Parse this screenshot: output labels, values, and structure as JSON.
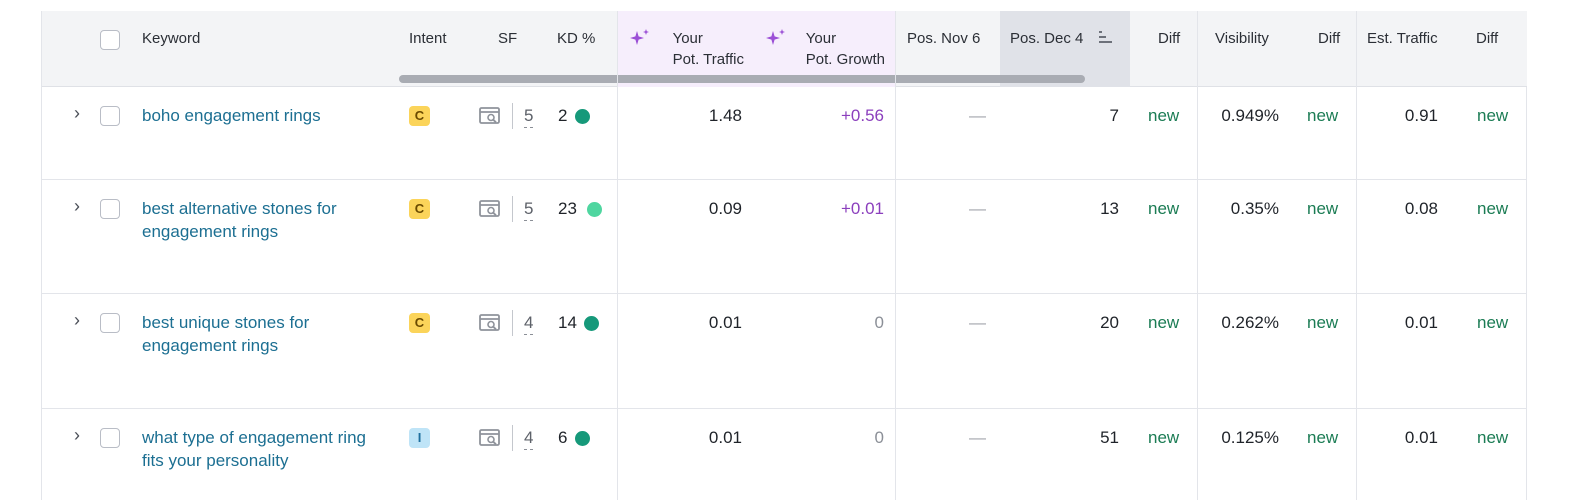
{
  "header": {
    "keyword": "Keyword",
    "intent": "Intent",
    "sf": "SF",
    "kd": "KD %",
    "pot_traffic_1": "Your",
    "pot_traffic_2": "Pot. Traffic",
    "pot_growth_1": "Your",
    "pot_growth_2": "Pot. Growth",
    "pos_prev": "Pos. Nov 6",
    "pos_curr": "Pos. Dec 4",
    "diff1": "Diff",
    "visibility": "Visibility",
    "diff2": "Diff",
    "est_traffic": "Est. Traffic",
    "diff3": "Diff"
  },
  "colors": {
    "kd_green_dark": "#16997a",
    "kd_green_light": "#4fd6a0",
    "ai_purple": "#9b4fd6"
  },
  "rows": [
    {
      "keyword": "boho engagement rings",
      "intent": "C",
      "sf": "5",
      "kd": "2",
      "pot_traffic": "1.48",
      "pot_growth": "+0.56",
      "pos_prev": "—",
      "pos_curr": "7",
      "diff1": "new",
      "visibility": "0.949%",
      "diff2": "new",
      "est_traffic": "0.91",
      "diff3": "new"
    },
    {
      "keyword": "best alternative stones for engagement rings",
      "intent": "C",
      "sf": "5",
      "kd": "23",
      "pot_traffic": "0.09",
      "pot_growth": "+0.01",
      "pos_prev": "—",
      "pos_curr": "13",
      "diff1": "new",
      "visibility": "0.35%",
      "diff2": "new",
      "est_traffic": "0.08",
      "diff3": "new"
    },
    {
      "keyword": "best unique stones for engagement rings",
      "intent": "C",
      "sf": "4",
      "kd": "14",
      "pot_traffic": "0.01",
      "pot_growth": "0",
      "pos_prev": "—",
      "pos_curr": "20",
      "diff1": "new",
      "visibility": "0.262%",
      "diff2": "new",
      "est_traffic": "0.01",
      "diff3": "new"
    },
    {
      "keyword": "what type of engagement ring fits your personality",
      "intent": "I",
      "sf": "4",
      "kd": "6",
      "pot_traffic": "0.01",
      "pot_growth": "0",
      "pos_prev": "—",
      "pos_curr": "51",
      "diff1": "new",
      "visibility": "0.125%",
      "diff2": "new",
      "est_traffic": "0.01",
      "diff3": "new"
    }
  ]
}
